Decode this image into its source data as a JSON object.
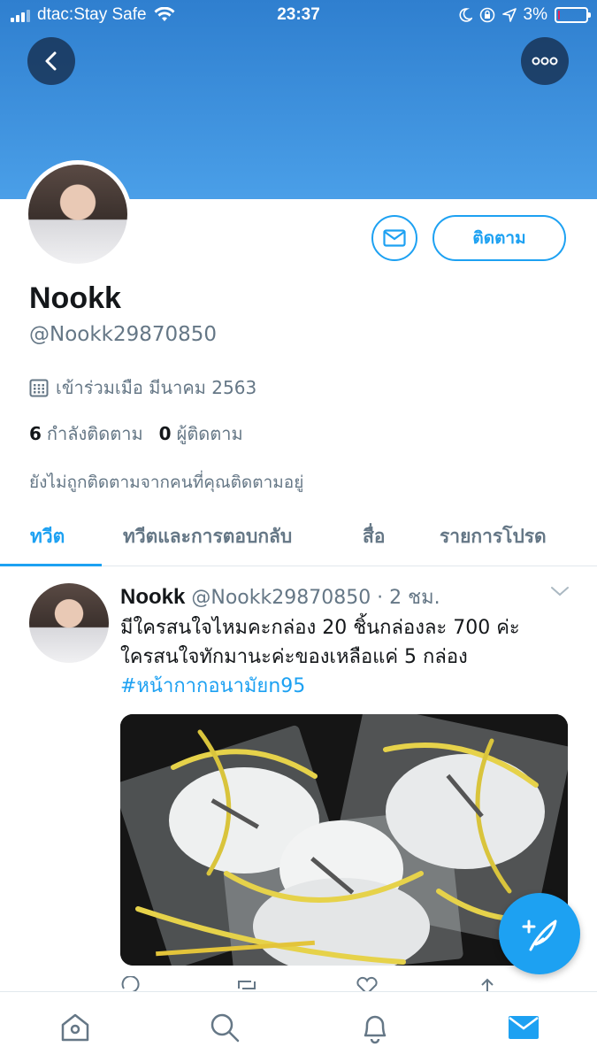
{
  "status_bar": {
    "carrier": "dtac:Stay Safe",
    "time": "23:37",
    "battery": "3%",
    "battery_level": 0.03,
    "icons": [
      "signal-icon",
      "wifi-icon",
      "moon-icon",
      "orientation-lock-icon",
      "location-icon",
      "battery-icon"
    ]
  },
  "banner": {
    "color": "#3b8fdc"
  },
  "profile": {
    "name": "Nookk",
    "handle": "@Nookk29870850",
    "joined": "เข้าร่วมเมือ มีนาคม 2563",
    "following_count": "6",
    "following_label": "กำลังติดตาม",
    "followers_count": "0",
    "followers_label": "ผู้ติดตาม",
    "not_followed_note": "ยังไม่ถูกติดตามจากคนที่คุณติดตามอยู่",
    "follow_button": "ติดตาม"
  },
  "tabs": [
    {
      "label": "ทวีต",
      "active": true
    },
    {
      "label": "ทวีตและการตอบกลับ",
      "active": false
    },
    {
      "label": "สื่อ",
      "active": false
    },
    {
      "label": "รายการโปรด",
      "active": false
    }
  ],
  "tweet": {
    "name": "Nookk",
    "meta": "@Nookk29870850 · 2 ชม.",
    "line1": "มีใครสนใจไหมคะกล่อง 20 ชิ้นกล่องละ 700 ค่ะ",
    "line2": "ใครสนใจทักมานะค่ะของเหลือแค่ 5 กล่อง",
    "hashtag": "#หน้ากากอนามัยn95"
  },
  "accent_color": "#1da1f2",
  "bottom_nav": [
    "home-icon",
    "search-icon",
    "notifications-icon",
    "messages-icon"
  ]
}
